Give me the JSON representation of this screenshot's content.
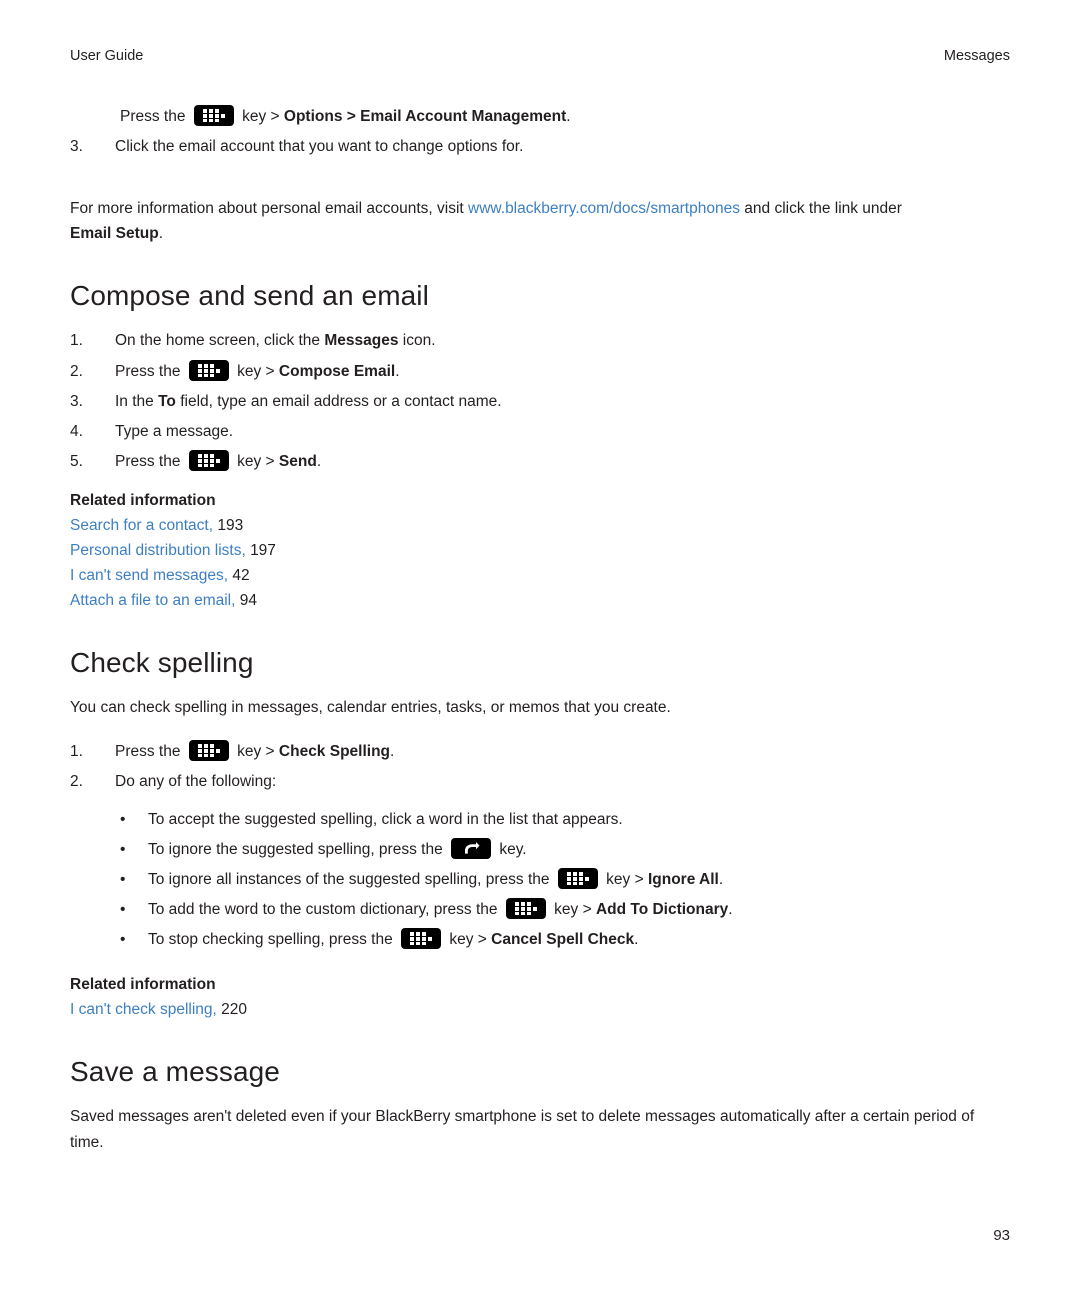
{
  "header": {
    "left": "User Guide",
    "right": "Messages"
  },
  "top_section": {
    "step_press_prefix": "Press the",
    "step_press_mid": "key >",
    "step_press_bold1": "Options",
    "step_press_sep": ">",
    "step_press_bold2": "Email Account Management",
    "step_press_end": ".",
    "step3_num": "3.",
    "step3_text": "Click the email account that you want to change options for.",
    "info_pre": "For more information about personal email accounts, visit",
    "info_link": "www.blackberry.com/docs/smartphones",
    "info_post": "and click the link under",
    "info_bold": "Email Setup",
    "info_end": "."
  },
  "compose": {
    "heading": "Compose and send an email",
    "steps": [
      {
        "num": "1.",
        "parts": [
          {
            "t": "On the home screen, click the ",
            "b": false
          },
          {
            "t": "Messages",
            "b": true
          },
          {
            "t": " icon.",
            "b": false
          }
        ]
      },
      {
        "num": "2.",
        "key": true,
        "pre": "Press the",
        "mid": "key >",
        "bold": "Compose Email",
        "end": "."
      },
      {
        "num": "3.",
        "parts": [
          {
            "t": "In the ",
            "b": false
          },
          {
            "t": "To",
            "b": true
          },
          {
            "t": " field, type an email address or a contact name.",
            "b": false
          }
        ]
      },
      {
        "num": "4.",
        "parts": [
          {
            "t": "Type a message.",
            "b": false
          }
        ]
      },
      {
        "num": "5.",
        "key": true,
        "pre": "Press the",
        "mid": "key >",
        "bold": "Send",
        "end": "."
      }
    ],
    "related_heading": "Related information",
    "related": [
      {
        "label": "Search for a contact,",
        "page": "193"
      },
      {
        "label": "Personal distribution lists,",
        "page": "197"
      },
      {
        "label": "I can't send messages,",
        "page": "42"
      },
      {
        "label": "Attach a file to an email,",
        "page": "94"
      }
    ]
  },
  "spelling": {
    "heading": "Check spelling",
    "intro": "You can check spelling in messages, calendar entries, tasks, or memos that you create.",
    "step1_num": "1.",
    "step1_pre": "Press the",
    "step1_mid": "key >",
    "step1_bold": "Check Spelling",
    "step1_end": ".",
    "step2_num": "2.",
    "step2_text": "Do any of the following:",
    "bullets": [
      {
        "marker": "•",
        "pre": "To accept the suggested spelling, click a word in the list that appears.",
        "key": "none"
      },
      {
        "marker": "•",
        "pre": "To ignore the suggested spelling, press the",
        "key": "escape",
        "mid": "key.",
        "bold": "",
        "end": ""
      },
      {
        "marker": "•",
        "pre": "To ignore all instances of the suggested spelling, press the",
        "key": "menu",
        "mid": "key >",
        "bold": "Ignore All",
        "end": "."
      },
      {
        "marker": "•",
        "pre": "To add the word to the custom dictionary, press the",
        "key": "menu",
        "mid": "key >",
        "bold": "Add To Dictionary",
        "end": "."
      },
      {
        "marker": "•",
        "pre": "To stop checking spelling, press the",
        "key": "menu",
        "mid": "key >",
        "bold": "Cancel Spell Check",
        "end": "."
      }
    ],
    "related_heading": "Related information",
    "related": [
      {
        "label": "I can't check spelling,",
        "page": "220"
      }
    ]
  },
  "save": {
    "heading": "Save a message",
    "text": "Saved messages aren't deleted even if your BlackBerry smartphone is set to delete messages automatically after a certain period of time."
  },
  "footer": {
    "page_number": "93"
  },
  "colors": {
    "link": "#3d7fc1",
    "text": "#231f20"
  }
}
